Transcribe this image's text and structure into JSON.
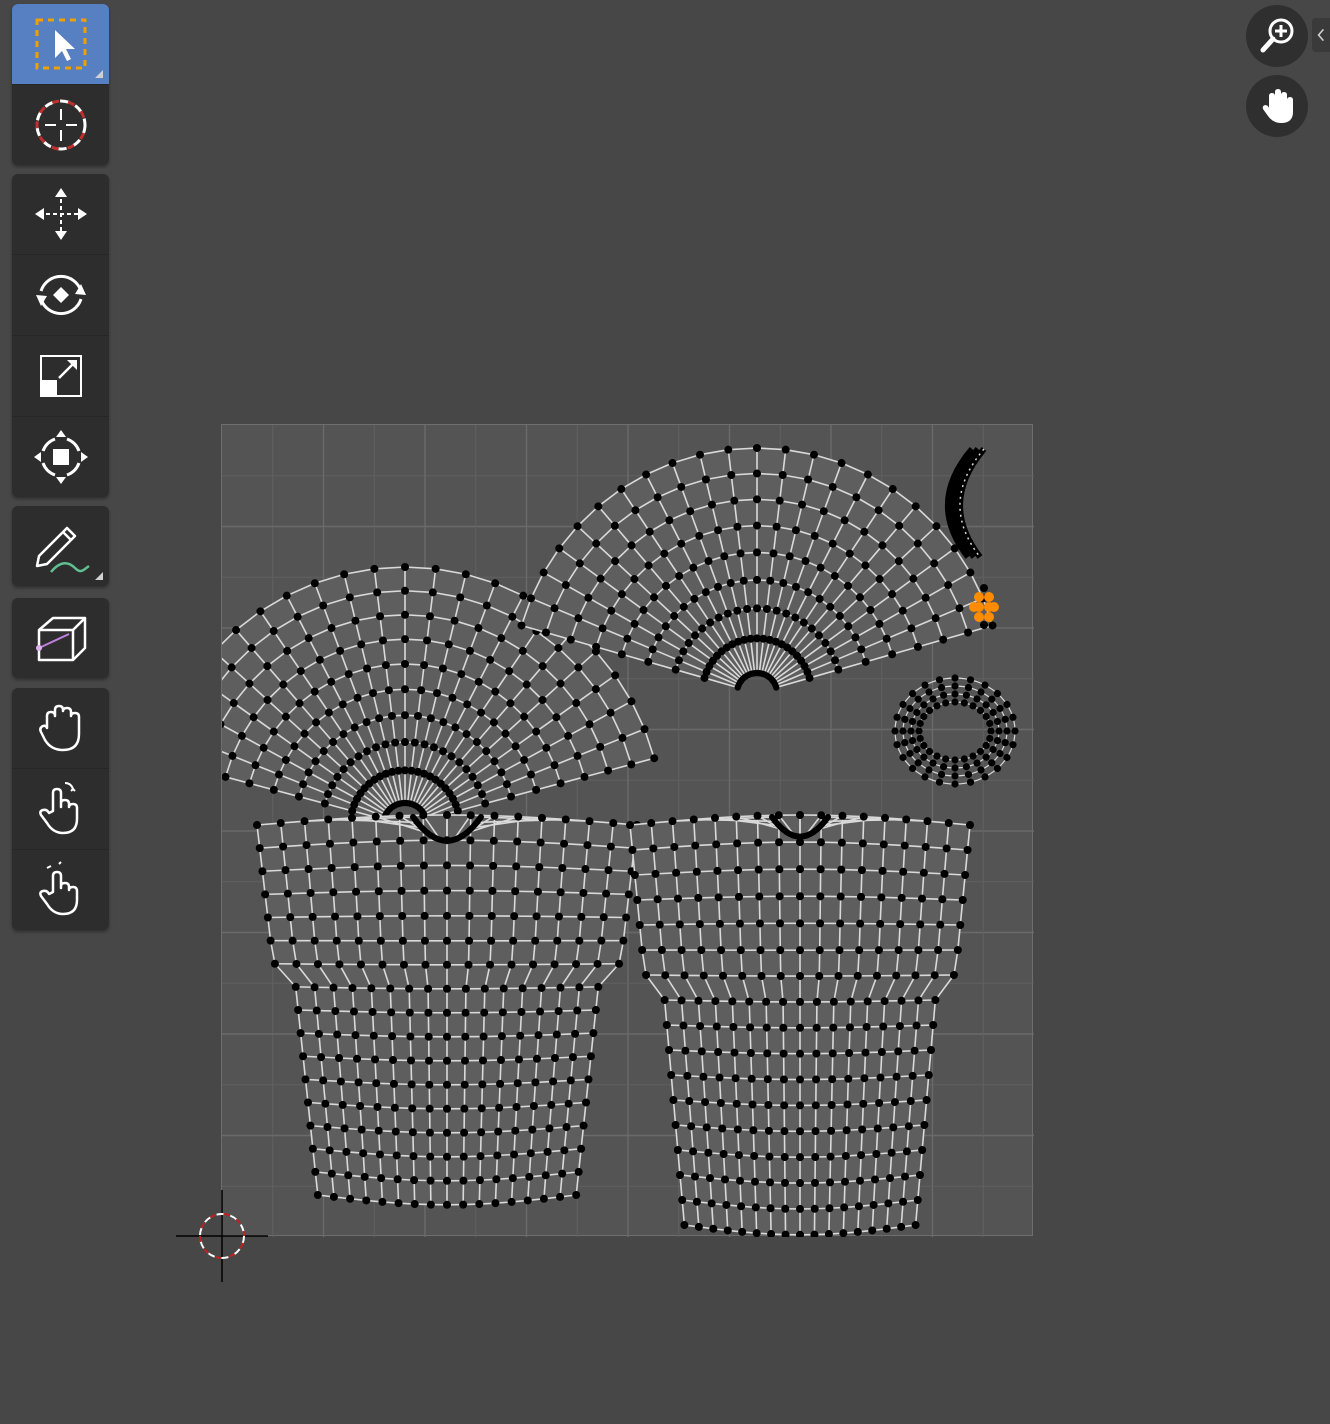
{
  "toolbar": {
    "groups": [
      {
        "tools": [
          {
            "name": "select-box",
            "icon": "select-box-icon",
            "active": true,
            "has_submenu": true
          },
          {
            "name": "cursor",
            "icon": "cursor-icon",
            "active": false,
            "has_submenu": false
          }
        ]
      },
      {
        "tools": [
          {
            "name": "move",
            "icon": "move-icon",
            "active": false,
            "has_submenu": false
          },
          {
            "name": "rotate",
            "icon": "rotate-icon",
            "active": false,
            "has_submenu": false
          },
          {
            "name": "scale",
            "icon": "scale-icon",
            "active": false,
            "has_submenu": false
          },
          {
            "name": "transform",
            "icon": "transform-icon",
            "active": false,
            "has_submenu": false
          }
        ]
      },
      {
        "tools": [
          {
            "name": "annotate",
            "icon": "annotate-icon",
            "active": false,
            "has_submenu": true
          }
        ]
      },
      {
        "tools": [
          {
            "name": "rip-region",
            "icon": "rip-region-icon",
            "active": false,
            "has_submenu": false
          }
        ]
      },
      {
        "tools": [
          {
            "name": "grab",
            "icon": "grab-icon",
            "active": false,
            "has_submenu": false
          },
          {
            "name": "relax",
            "icon": "relax-icon",
            "active": false,
            "has_submenu": false
          },
          {
            "name": "pinch",
            "icon": "pinch-icon",
            "active": false,
            "has_submenu": false
          }
        ]
      }
    ]
  },
  "navigation": {
    "zoom_icon": "zoom-in-icon",
    "pan_icon": "hand-pan-icon",
    "collapse_icon": "chevron-left-icon"
  },
  "colors": {
    "background": "#474747",
    "active_tool": "#5680c2",
    "uv_vertex": "#000000",
    "uv_edge": "#d9d9d9",
    "selected_vertex": "#ff8c00"
  }
}
